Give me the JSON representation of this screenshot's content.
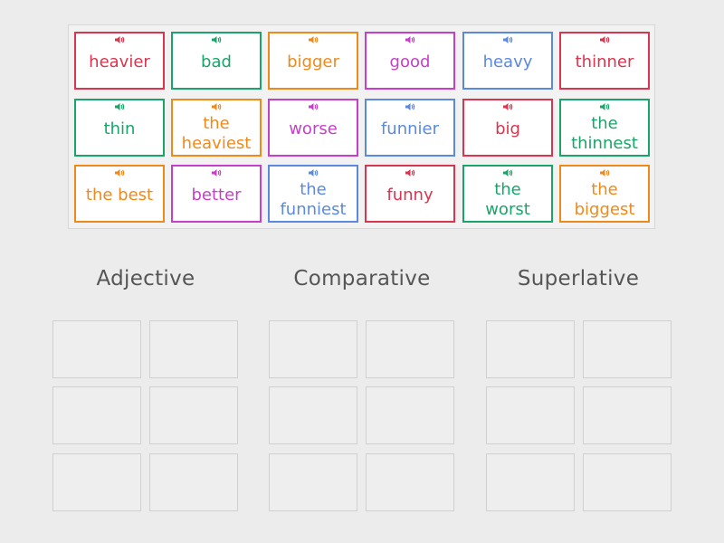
{
  "colors": {
    "red": "#d9354e",
    "green": "#1aa469",
    "orange": "#ee8a1c",
    "purple": "#c63fc8",
    "blue": "#5b89dd"
  },
  "cards": [
    {
      "text": "heavier",
      "color": "red",
      "icon": "speaker-icon"
    },
    {
      "text": "bad",
      "color": "green",
      "icon": "speaker-icon"
    },
    {
      "text": "bigger",
      "color": "orange",
      "icon": "speaker-icon"
    },
    {
      "text": "good",
      "color": "purple",
      "icon": "speaker-icon"
    },
    {
      "text": "heavy",
      "color": "blue",
      "icon": "speaker-icon"
    },
    {
      "text": "thinner",
      "color": "red",
      "icon": "speaker-icon"
    },
    {
      "text": "thin",
      "color": "green",
      "icon": "speaker-icon"
    },
    {
      "text": "the heaviest",
      "color": "orange",
      "icon": "speaker-icon"
    },
    {
      "text": "worse",
      "color": "purple",
      "icon": "speaker-icon"
    },
    {
      "text": "funnier",
      "color": "blue",
      "icon": "speaker-icon"
    },
    {
      "text": "big",
      "color": "red",
      "icon": "speaker-icon"
    },
    {
      "text": "the thinnest",
      "color": "green",
      "icon": "speaker-icon"
    },
    {
      "text": "the best",
      "color": "orange",
      "icon": "speaker-icon"
    },
    {
      "text": "better",
      "color": "purple",
      "icon": "speaker-icon"
    },
    {
      "text": "the funniest",
      "color": "blue",
      "icon": "speaker-icon"
    },
    {
      "text": "funny",
      "color": "red",
      "icon": "speaker-icon"
    },
    {
      "text": "the worst",
      "color": "green",
      "icon": "speaker-icon"
    },
    {
      "text": "the biggest",
      "color": "orange",
      "icon": "speaker-icon"
    }
  ],
  "groups": [
    {
      "title": "Adjective",
      "slots": 6
    },
    {
      "title": "Comparative",
      "slots": 6
    },
    {
      "title": "Superlative",
      "slots": 6
    }
  ]
}
